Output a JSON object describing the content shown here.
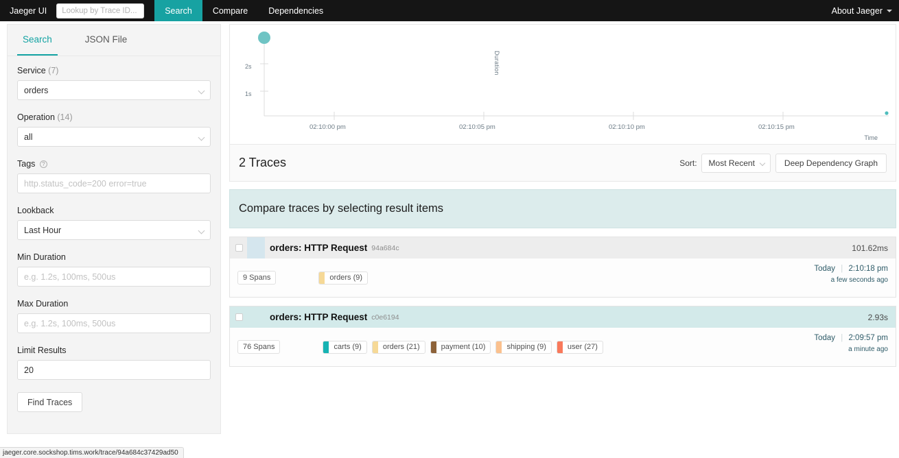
{
  "topnav": {
    "brand": "Jaeger UI",
    "traceid_placeholder": "Lookup by Trace ID...",
    "links": [
      {
        "label": "Search",
        "active": true
      },
      {
        "label": "Compare",
        "active": false
      },
      {
        "label": "Dependencies",
        "active": false
      }
    ],
    "about": "About Jaeger",
    "accent_color": "#17a2a2"
  },
  "sidepanel": {
    "tabs": [
      {
        "label": "Search",
        "active": true
      },
      {
        "label": "JSON File",
        "active": false
      }
    ],
    "service": {
      "label": "Service",
      "count": "(7)",
      "value": "orders"
    },
    "operation": {
      "label": "Operation",
      "count": "(14)",
      "value": "all"
    },
    "tags": {
      "label": "Tags",
      "placeholder": "http.status_code=200 error=true",
      "value": ""
    },
    "lookback": {
      "label": "Lookback",
      "value": "Last Hour"
    },
    "min_duration": {
      "label": "Min Duration",
      "placeholder": "e.g. 1.2s, 100ms, 500us",
      "value": ""
    },
    "max_duration": {
      "label": "Max Duration",
      "placeholder": "e.g. 1.2s, 100ms, 500us",
      "value": ""
    },
    "limit_results": {
      "label": "Limit Results",
      "value": "20"
    },
    "find_button": "Find Traces"
  },
  "chart_data": {
    "type": "scatter",
    "title": "",
    "xlabel": "Time",
    "ylabel": "Duration",
    "x_ticks": [
      "02:10:00 pm",
      "02:10:05 pm",
      "02:10:10 pm",
      "02:10:15 pm"
    ],
    "y_ticks": [
      "1s",
      "2s"
    ],
    "ylim": [
      0,
      3.2
    ],
    "grid": false,
    "legend": null,
    "points": [
      {
        "label": "c0e6194",
        "time": "02:09:57 pm",
        "duration_s": 2.93,
        "radius": 9,
        "color": "#6fc4c4"
      },
      {
        "label": "94a684c",
        "time": "02:10:18 pm",
        "duration_s": 0.10162,
        "radius": 2.5,
        "color": "#4fbdbd"
      }
    ]
  },
  "results": {
    "count_label": "2 Traces",
    "sort_label": "Sort:",
    "sort_value": "Most Recent",
    "ddg_button": "Deep Dependency Graph",
    "compare_banner": "Compare traces by selecting result items"
  },
  "traces": [
    {
      "name": "orders: HTTP Request",
      "id": "94a684c",
      "duration": "101.62ms",
      "spans": "9 Spans",
      "header_style": "grey",
      "accent_color": "#d5e6ee",
      "services": [
        {
          "name": "orders (9)",
          "color": "#f6d997"
        }
      ],
      "day": "Today",
      "time": "2:10:18 pm",
      "ago": "a few seconds ago"
    },
    {
      "name": "orders: HTTP Request",
      "id": "c0e6194",
      "duration": "2.93s",
      "spans": "76 Spans",
      "header_style": "teal",
      "accent_color": "#d3eaea",
      "services": [
        {
          "name": "carts (9)",
          "color": "#17b3b3"
        },
        {
          "name": "orders (21)",
          "color": "#f6d997"
        },
        {
          "name": "payment (10)",
          "color": "#8d6239"
        },
        {
          "name": "shipping (9)",
          "color": "#fbc18e"
        },
        {
          "name": "user (27)",
          "color": "#f9795b"
        }
      ],
      "day": "Today",
      "time": "2:09:57 pm",
      "ago": "a minute ago"
    }
  ],
  "statusbar": {
    "url": "jaeger.core.sockshop.tims.work/trace/94a684c37429ad50"
  }
}
